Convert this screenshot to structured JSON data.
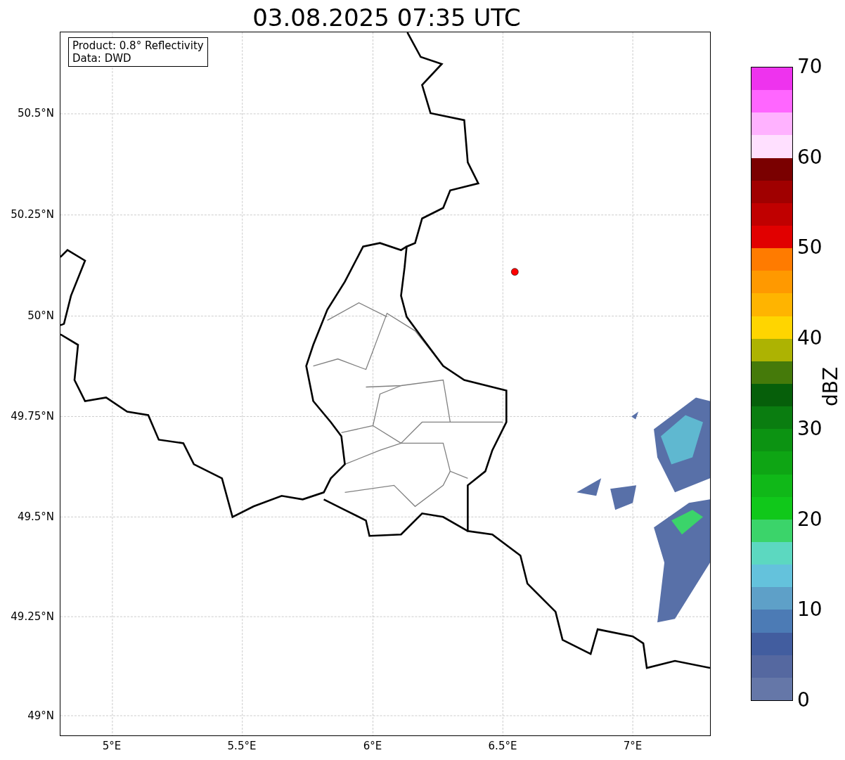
{
  "title": "03.08.2025 07:35 UTC",
  "info_box": [
    "Product: 0.8° Reflectivity",
    "Data: DWD"
  ],
  "map": {
    "y_ticks": [
      "50.5°N",
      "50.25°N",
      "50°N",
      "49.75°N",
      "49.5°N",
      "49.25°N",
      "49°N"
    ],
    "x_ticks": [
      "5°E",
      "5.5°E",
      "6°E",
      "6.5°E",
      "7°E"
    ]
  },
  "colorbar": {
    "label": "dBZ",
    "ticks": [
      "70",
      "60",
      "50",
      "40",
      "30",
      "20",
      "10",
      "0"
    ],
    "bins": [
      {
        "color": "#6577a8"
      },
      {
        "color": "#5568a0"
      },
      {
        "color": "#425d9f"
      },
      {
        "color": "#4c7bb5"
      },
      {
        "color": "#5ea0c8"
      },
      {
        "color": "#64c2dc"
      },
      {
        "color": "#5cd8c0"
      },
      {
        "color": "#3bd46a"
      },
      {
        "color": "#10c81a"
      },
      {
        "color": "#10b818"
      },
      {
        "color": "#0ea514"
      },
      {
        "color": "#0c9312"
      },
      {
        "color": "#0a7d10"
      },
      {
        "color": "#065f0a"
      },
      {
        "color": "#457a0a"
      },
      {
        "color": "#adb302"
      },
      {
        "color": "#ffd500"
      },
      {
        "color": "#ffb400"
      },
      {
        "color": "#ff9900"
      },
      {
        "color": "#ff7b00"
      },
      {
        "color": "#e10000"
      },
      {
        "color": "#c00000"
      },
      {
        "color": "#a00000"
      },
      {
        "color": "#7a0000"
      },
      {
        "color": "#ffe0ff"
      },
      {
        "color": "#ffb2ff"
      },
      {
        "color": "#ff66ff"
      },
      {
        "color": "#ee33ee"
      }
    ]
  }
}
